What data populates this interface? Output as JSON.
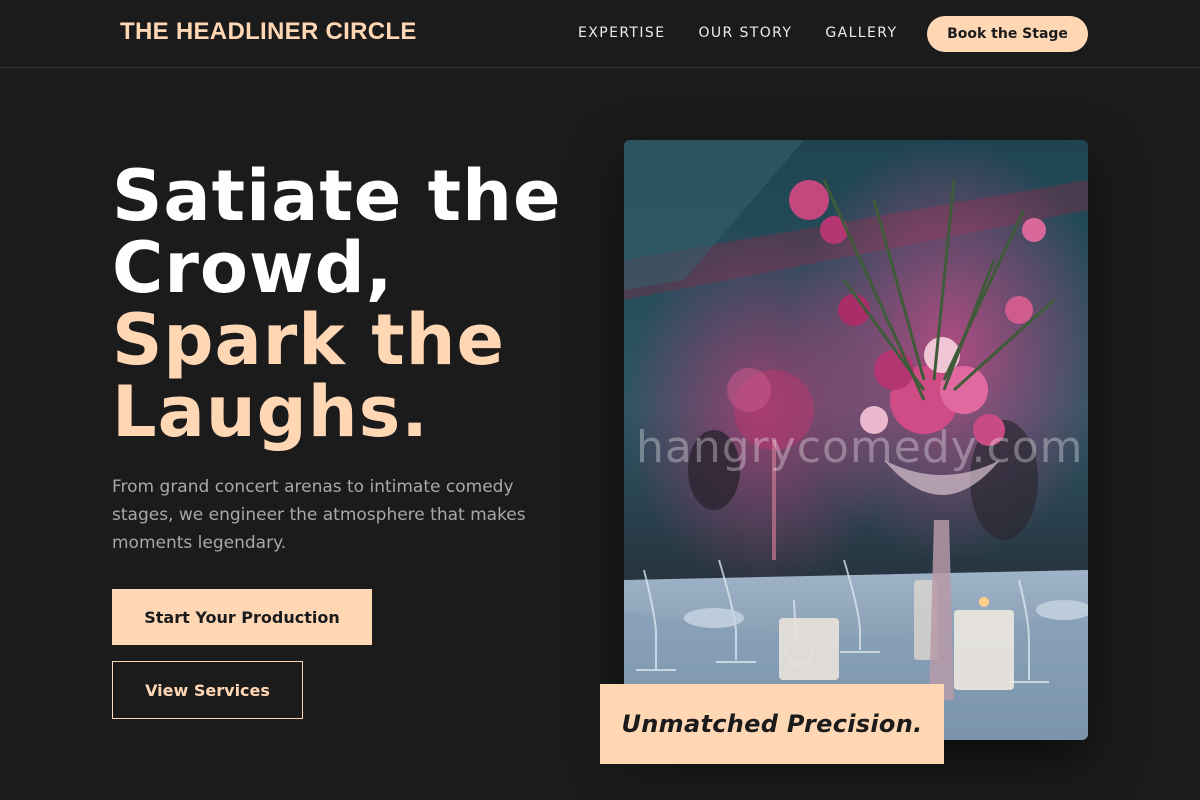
{
  "nav": {
    "brand": "THE HEADLINER CIRCLE",
    "links": [
      "EXPERTISE",
      "OUR STORY",
      "GALLERY"
    ],
    "cta_label": "Book the Stage"
  },
  "hero": {
    "headline": [
      "Satiate the",
      "Crowd,"
    ],
    "headline_accent": [
      "Spark the",
      "Laughs."
    ],
    "lede": "From grand concert arenas to intimate comedy stages, we engineer the atmosphere that makes moments legendary.",
    "primary_button": "Start Your Production",
    "secondary_button": "View Services",
    "watermark": "hangrycomedy.com",
    "caption": "Unmatched Precision."
  },
  "colors": {
    "background": "#1c1b1c",
    "accent": "#ffd7b5",
    "muted_text": "#a9a7a8"
  }
}
